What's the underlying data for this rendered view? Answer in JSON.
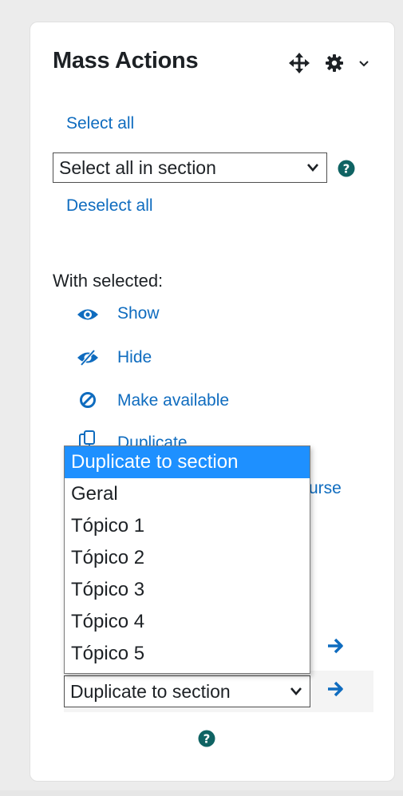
{
  "block": {
    "title": "Mass Actions",
    "icons": {
      "move": "move-icon",
      "settings": "gear-icon",
      "menu": "chevron-down-icon"
    }
  },
  "selection": {
    "select_all": "Select all",
    "section_select_value": "Select all in section",
    "deselect_all": "Deselect all"
  },
  "actions": {
    "heading": "With selected:",
    "items": [
      {
        "label": "Show",
        "icon": "eye-icon"
      },
      {
        "label": "Hide",
        "icon": "eye-slash-icon"
      },
      {
        "label": "Make available",
        "icon": "ban-icon"
      },
      {
        "label": "Duplicate",
        "icon": "copy-icon"
      },
      {
        "label": "urse",
        "icon": ""
      }
    ]
  },
  "duplicate_dropdown": {
    "options": [
      "Duplicate to section",
      "Geral",
      "Tópico 1",
      "Tópico 2",
      "Tópico 3",
      "Tópico 4",
      "Tópico 5"
    ],
    "selected_index": 0,
    "select_value": "Duplicate to section"
  },
  "colors": {
    "link": "#0f6cbf",
    "highlight": "#1e90ff",
    "help": "#0f6363"
  }
}
